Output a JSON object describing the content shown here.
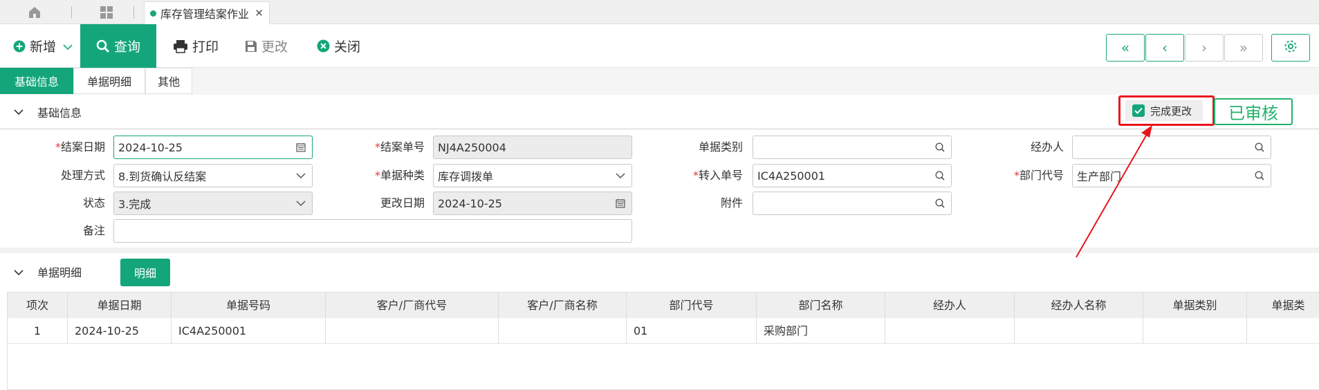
{
  "tabbar": {
    "home_icon": "home-icon",
    "apps_icon": "grid-icon",
    "doc_tab_label": "库存管理结案作业",
    "doc_tab_close": "✕"
  },
  "toolbar": {
    "new_label": "新增",
    "query_label": "查询",
    "print_label": "打印",
    "modify_label": "更改",
    "close_label": "关闭",
    "nav": [
      "«",
      "‹",
      "›",
      "»"
    ]
  },
  "subtabs": [
    "基础信息",
    "单据明细",
    "其他"
  ],
  "basic_section": {
    "title": "基础信息"
  },
  "approval": {
    "done_edit_label": "完成更改",
    "done_edit_checked": true,
    "status_label": "已审核"
  },
  "form": {
    "close_date": {
      "label": "结案日期",
      "required": "*",
      "value": "2024-10-25"
    },
    "close_no": {
      "label": "结案单号",
      "required": "*",
      "value": "NJ4A250004"
    },
    "doc_category": {
      "label": "单据类别",
      "value": ""
    },
    "handler": {
      "label": "经办人",
      "value": ""
    },
    "method": {
      "label": "处理方式",
      "value": "8.到货确认反结案"
    },
    "doc_kind": {
      "label": "单据种类",
      "required": "*",
      "value": "库存调拨单"
    },
    "transfer_no": {
      "label": "转入单号",
      "required": "*",
      "value": "IC4A250001"
    },
    "dept_code": {
      "label": "部门代号",
      "required": "*",
      "value": "生产部门"
    },
    "status": {
      "label": "状态",
      "value": "3.完成"
    },
    "modify_date": {
      "label": "更改日期",
      "value": "2024-10-25"
    },
    "attachment": {
      "label": "附件",
      "value": ""
    },
    "remark": {
      "label": "备注",
      "value": ""
    }
  },
  "detail_section": {
    "title": "单据明细",
    "detail_button": "明细"
  },
  "grid": {
    "columns": [
      "项次",
      "单据日期",
      "单据号码",
      "客户/厂商代号",
      "客户/厂商名称",
      "部门代号",
      "部门名称",
      "经办人",
      "经办人名称",
      "单据类别",
      "单据类"
    ],
    "rows": [
      [
        "1",
        "2024-10-25",
        "IC4A250001",
        "",
        "",
        "01",
        "采购部门",
        "",
        "",
        "",
        ""
      ]
    ]
  },
  "colors": {
    "accent": "#14a67a",
    "approved": "#20b26b",
    "highlight": "#e8141b",
    "required": "#e0393e"
  }
}
